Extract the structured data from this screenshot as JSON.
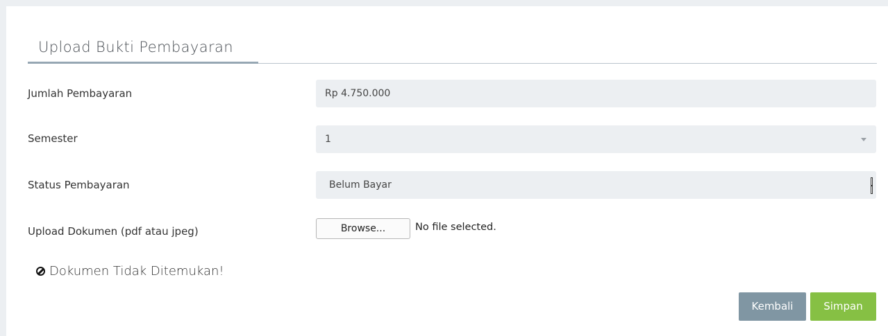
{
  "form": {
    "title": "Upload Bukti Pembayaran",
    "fields": [
      {
        "label": "Jumlah Pembayaran",
        "value": "Rp 4.750.000"
      },
      {
        "label": "Semester",
        "value": "1"
      },
      {
        "label": "Status Pembayaran",
        "value": "Belum Bayar"
      },
      {
        "label": "Upload Dokumen (pdf atau jpeg)"
      }
    ],
    "browse_label": "Browse...",
    "file_status": "No file selected.",
    "warning": "Dokumen Tidak Ditemukan!",
    "buttons": {
      "back": "Kembali",
      "save": "Simpan"
    }
  },
  "icons": {
    "warning_icon": "ban-icon",
    "select_caret": "chevron-down-icon"
  },
  "colors": {
    "back_button": "#8096a3",
    "save_button": "#86c044",
    "field_bg": "#eceff2"
  }
}
